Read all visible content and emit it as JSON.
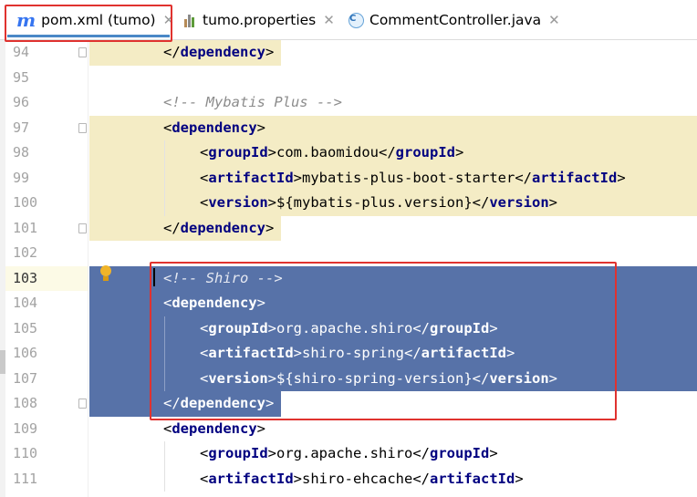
{
  "tabs": [
    {
      "label": "pom.xml (tumo)",
      "icon": "maven-m-icon",
      "active": true
    },
    {
      "label": "tumo.properties",
      "icon": "properties-file-icon",
      "active": false
    },
    {
      "label": "CommentController.java",
      "icon": "java-class-icon",
      "active": false
    }
  ],
  "icons": {
    "maven_glyph": "m",
    "class_glyph": "C",
    "close_glyph": "✕"
  },
  "colors": {
    "tag": "#000080",
    "comment": "#8c8c8c",
    "selection": "#5772a8",
    "highlight_box": "#e0322f",
    "fold_highlight": "#f4ecc5"
  },
  "lines": [
    {
      "num": "94",
      "indent": 1,
      "parts": [
        [
          "b",
          "</"
        ],
        [
          "t",
          "dependency"
        ],
        [
          "b",
          ">"
        ]
      ]
    },
    {
      "num": "95",
      "indent": 0,
      "parts": []
    },
    {
      "num": "96",
      "indent": 1,
      "parts": [
        [
          "c",
          "<!-- Mybatis Plus -->"
        ]
      ]
    },
    {
      "num": "97",
      "indent": 1,
      "parts": [
        [
          "b",
          "<"
        ],
        [
          "t",
          "dependency"
        ],
        [
          "b",
          ">"
        ]
      ]
    },
    {
      "num": "98",
      "indent": 2,
      "parts": [
        [
          "b",
          "<"
        ],
        [
          "t",
          "groupId"
        ],
        [
          "b",
          ">"
        ],
        [
          "x",
          "com.baomidou"
        ],
        [
          "b",
          "</"
        ],
        [
          "t",
          "groupId"
        ],
        [
          "b",
          ">"
        ]
      ]
    },
    {
      "num": "99",
      "indent": 2,
      "parts": [
        [
          "b",
          "<"
        ],
        [
          "t",
          "artifactId"
        ],
        [
          "b",
          ">"
        ],
        [
          "x",
          "mybatis-plus-boot-starter"
        ],
        [
          "b",
          "</"
        ],
        [
          "t",
          "artifactId"
        ],
        [
          "b",
          ">"
        ]
      ]
    },
    {
      "num": "100",
      "indent": 2,
      "parts": [
        [
          "b",
          "<"
        ],
        [
          "t",
          "version"
        ],
        [
          "b",
          ">"
        ],
        [
          "x",
          "${mybatis-plus.version}"
        ],
        [
          "b",
          "</"
        ],
        [
          "t",
          "version"
        ],
        [
          "b",
          ">"
        ]
      ]
    },
    {
      "num": "101",
      "indent": 1,
      "parts": [
        [
          "b",
          "</"
        ],
        [
          "t",
          "dependency"
        ],
        [
          "b",
          ">"
        ]
      ]
    },
    {
      "num": "102",
      "indent": 0,
      "parts": []
    },
    {
      "num": "103",
      "indent": 1,
      "parts": [
        [
          "c",
          "<!-- Shiro -->"
        ]
      ]
    },
    {
      "num": "104",
      "indent": 1,
      "parts": [
        [
          "b",
          "<"
        ],
        [
          "t",
          "dependency"
        ],
        [
          "b",
          ">"
        ]
      ]
    },
    {
      "num": "105",
      "indent": 2,
      "parts": [
        [
          "b",
          "<"
        ],
        [
          "t",
          "groupId"
        ],
        [
          "b",
          ">"
        ],
        [
          "x",
          "org.apache.shiro"
        ],
        [
          "b",
          "</"
        ],
        [
          "t",
          "groupId"
        ],
        [
          "b",
          ">"
        ]
      ]
    },
    {
      "num": "106",
      "indent": 2,
      "parts": [
        [
          "b",
          "<"
        ],
        [
          "t",
          "artifactId"
        ],
        [
          "b",
          ">"
        ],
        [
          "x",
          "shiro-spring"
        ],
        [
          "b",
          "</"
        ],
        [
          "t",
          "artifactId"
        ],
        [
          "b",
          ">"
        ]
      ]
    },
    {
      "num": "107",
      "indent": 2,
      "parts": [
        [
          "b",
          "<"
        ],
        [
          "t",
          "version"
        ],
        [
          "b",
          ">"
        ],
        [
          "x",
          "${shiro-spring-version}"
        ],
        [
          "b",
          "</"
        ],
        [
          "t",
          "version"
        ],
        [
          "b",
          ">"
        ]
      ]
    },
    {
      "num": "108",
      "indent": 1,
      "parts": [
        [
          "b",
          "</"
        ],
        [
          "t",
          "dependency"
        ],
        [
          "b",
          ">"
        ]
      ]
    },
    {
      "num": "109",
      "indent": 1,
      "parts": [
        [
          "b",
          "<"
        ],
        [
          "t",
          "dependency"
        ],
        [
          "b",
          ">"
        ]
      ]
    },
    {
      "num": "110",
      "indent": 2,
      "parts": [
        [
          "b",
          "<"
        ],
        [
          "t",
          "groupId"
        ],
        [
          "b",
          ">"
        ],
        [
          "x",
          "org.apache.shiro"
        ],
        [
          "b",
          "</"
        ],
        [
          "t",
          "groupId"
        ],
        [
          "b",
          ">"
        ]
      ]
    },
    {
      "num": "111",
      "indent": 2,
      "parts": [
        [
          "b",
          "<"
        ],
        [
          "t",
          "artifactId"
        ],
        [
          "b",
          ">"
        ],
        [
          "x",
          "shiro-ehcache"
        ],
        [
          "b",
          "</"
        ],
        [
          "t",
          "artifactId"
        ],
        [
          "b",
          ">"
        ]
      ]
    }
  ]
}
